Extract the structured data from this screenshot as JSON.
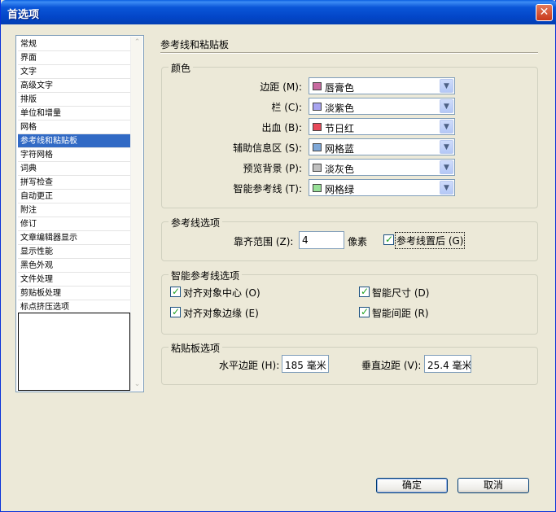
{
  "window": {
    "title": "首选项",
    "close_label": "✕"
  },
  "sidebar": {
    "items": [
      {
        "label": "常规"
      },
      {
        "label": "界面"
      },
      {
        "label": "文字"
      },
      {
        "label": "高级文字"
      },
      {
        "label": "排版"
      },
      {
        "label": "单位和增量"
      },
      {
        "label": "网格"
      },
      {
        "label": "参考线和粘贴板",
        "selected": true
      },
      {
        "label": "字符网格"
      },
      {
        "label": "词典"
      },
      {
        "label": "拼写检查"
      },
      {
        "label": "自动更正"
      },
      {
        "label": "附注"
      },
      {
        "label": "修订"
      },
      {
        "label": "文章编辑器显示"
      },
      {
        "label": "显示性能"
      },
      {
        "label": "黑色外观"
      },
      {
        "label": "文件处理"
      },
      {
        "label": "剪贴板处理"
      },
      {
        "label": "标点挤压选项"
      }
    ]
  },
  "main": {
    "title": "参考线和粘贴板",
    "color_group": {
      "label": "颜色",
      "rows": [
        {
          "label": "边距 (M):",
          "value": "唇膏色",
          "swatch": "#c86aa0"
        },
        {
          "label": "栏 (C):",
          "value": "淡紫色",
          "swatch": "#a8a4f0"
        },
        {
          "label": "出血 (B):",
          "value": "节日红",
          "swatch": "#e84a5a"
        },
        {
          "label": "辅助信息区 (S):",
          "value": "网格蓝",
          "swatch": "#7fa8d8"
        },
        {
          "label": "预览背景 (P):",
          "value": "淡灰色",
          "swatch": "#c0c0c0"
        },
        {
          "label": "智能参考线 (T):",
          "value": "网格绿",
          "swatch": "#98e098"
        }
      ]
    },
    "guide_options": {
      "label": "参考线选项",
      "snap_label": "靠齐范围 (Z):",
      "snap_value": "4",
      "snap_unit": "像素",
      "behind_label": "参考线置后 (G)",
      "behind_checked": true
    },
    "smart_guide_options": {
      "label": "智能参考线选项",
      "items": [
        {
          "label": "对齐对象中心 (O)",
          "checked": true
        },
        {
          "label": "智能尺寸 (D)",
          "checked": true
        },
        {
          "label": "对齐对象边缘 (E)",
          "checked": true
        },
        {
          "label": "智能间距 (R)",
          "checked": true
        }
      ]
    },
    "pasteboard_options": {
      "label": "粘贴板选项",
      "h_label": "水平边距 (H):",
      "h_value": "185 毫米",
      "v_label": "垂直边距 (V):",
      "v_value": "25.4 毫米"
    }
  },
  "buttons": {
    "ok": "确定",
    "cancel": "取消"
  }
}
